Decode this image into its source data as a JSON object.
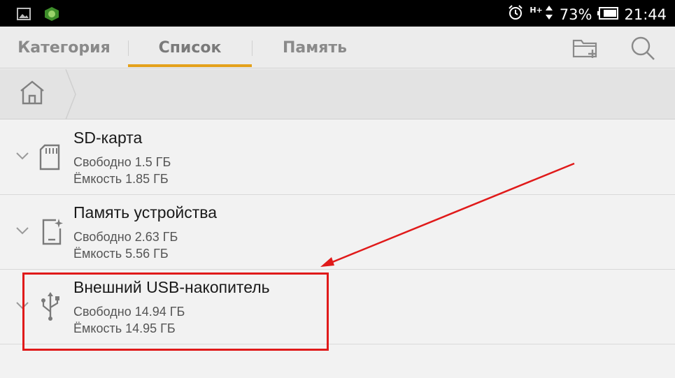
{
  "status_bar": {
    "network": "H+",
    "battery_percent": "73%",
    "time": "21:44",
    "icons": [
      "gallery-icon",
      "android-bug-icon",
      "alarm-icon",
      "signal-icon",
      "battery-icon"
    ]
  },
  "tabs": [
    {
      "label": "Категория",
      "active": false
    },
    {
      "label": "Список",
      "active": true
    },
    {
      "label": "Память",
      "active": false
    }
  ],
  "toolbar": {
    "new_folder_icon": "new-folder-icon",
    "search_icon": "search-icon"
  },
  "breadcrumb": {
    "home_icon": "home-icon"
  },
  "storage": [
    {
      "name": "SD-карта",
      "free": "Свободно 1.5 ГБ",
      "capacity": "Ёмкость 1.85 ГБ",
      "icon": "sd-card-icon"
    },
    {
      "name": "Память устройства",
      "free": "Свободно 2.63 ГБ",
      "capacity": "Ёмкость 5.56 ГБ",
      "icon": "phone-storage-icon"
    },
    {
      "name": "Внешний USB-накопитель",
      "free": "Свободно 14.94 ГБ",
      "capacity": "Ёмкость 14.95 ГБ",
      "icon": "usb-icon"
    }
  ],
  "colors": {
    "accent": "#e4a11b",
    "annotation": "#e01a1a"
  }
}
